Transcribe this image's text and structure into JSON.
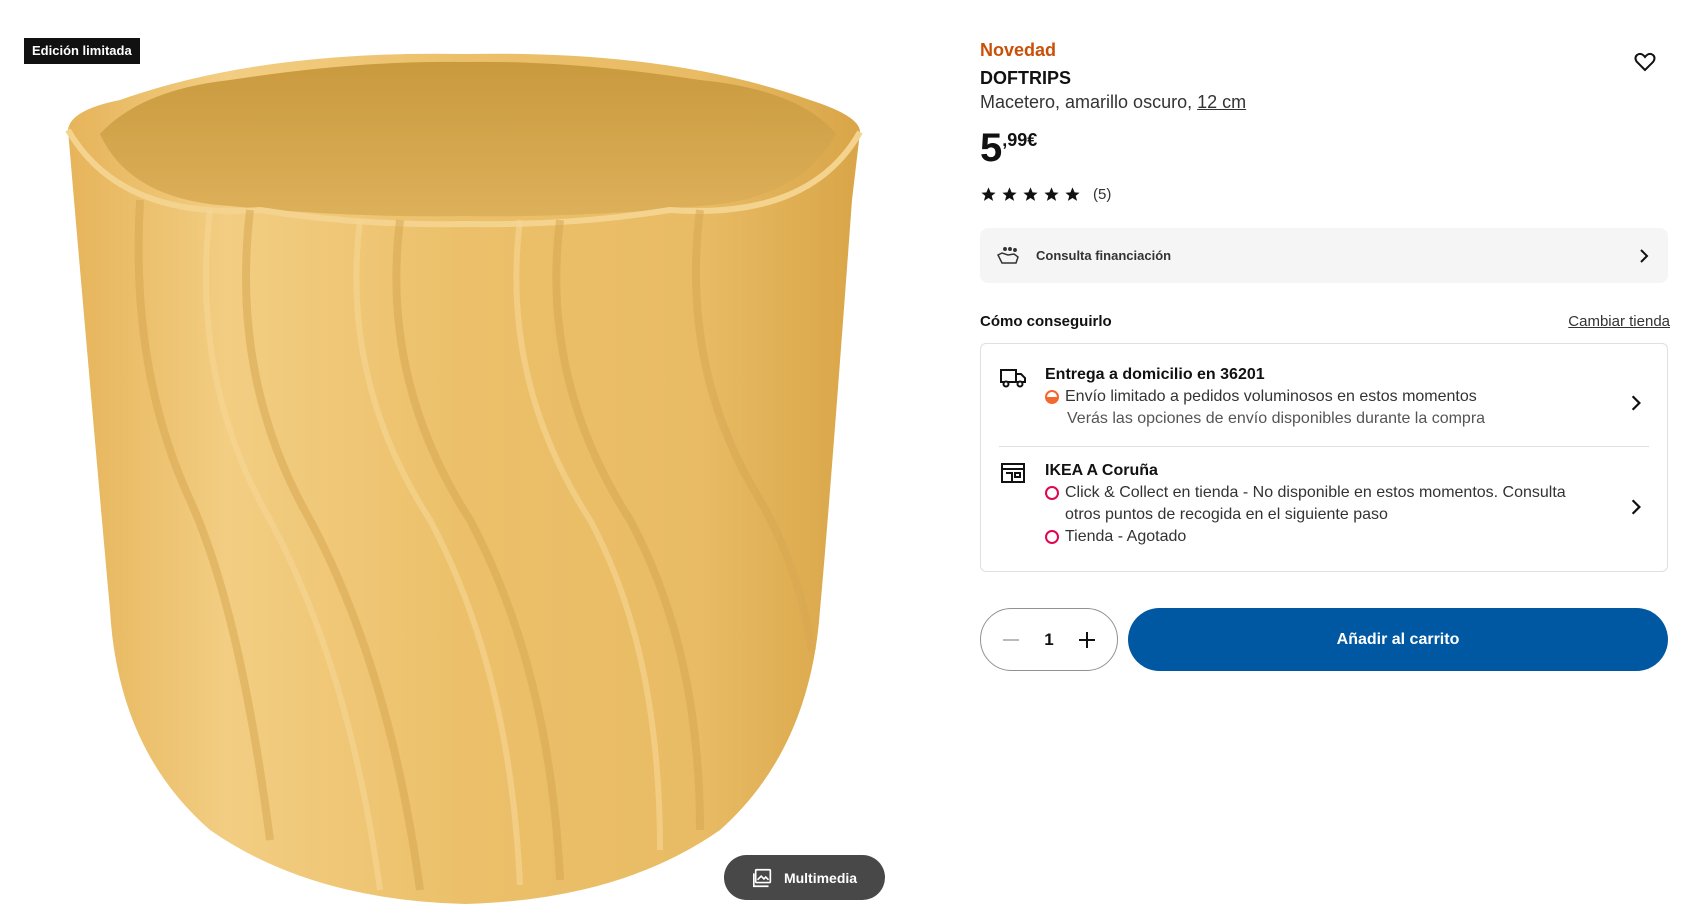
{
  "media": {
    "badge": "Edición limitada",
    "multimedia_label": "Multimedia"
  },
  "product": {
    "tag": "Novedad",
    "name": "DOFTRIPS",
    "description": "Macetero, amarillo oscuro,",
    "size_link": "12 cm",
    "price_int": "5",
    "price_dec": ",99€",
    "rating_stars": 5,
    "rating_count": "(5)"
  },
  "financing": {
    "label": "Consulta financiación"
  },
  "availability": {
    "title": "Cómo conseguirlo",
    "change_store": "Cambiar tienda",
    "delivery": {
      "title": "Entrega a domicilio en 36201",
      "status": "Envío limitado a pedidos voluminosos en estos momentos",
      "note": "Verás las opciones de envío disponibles durante la compra"
    },
    "store": {
      "title": "IKEA A Coruña",
      "click_collect": "Click & Collect en tienda - No disponible en estos momentos. Consulta otros puntos de recogida en el siguiente paso",
      "in_store": "Tienda - Agotado"
    }
  },
  "purchase": {
    "quantity": "1",
    "add_to_cart": "Añadir al carrito"
  },
  "colors": {
    "accent_orange": "#ca5008",
    "primary_blue": "#0058a3",
    "status_orange": "#f26a2e",
    "status_red": "#e00751"
  },
  "icons": [
    "heart-icon",
    "star-icon",
    "financing-icon",
    "chevron-right-icon",
    "truck-icon",
    "store-icon",
    "minus-icon",
    "plus-icon",
    "media-icon"
  ]
}
